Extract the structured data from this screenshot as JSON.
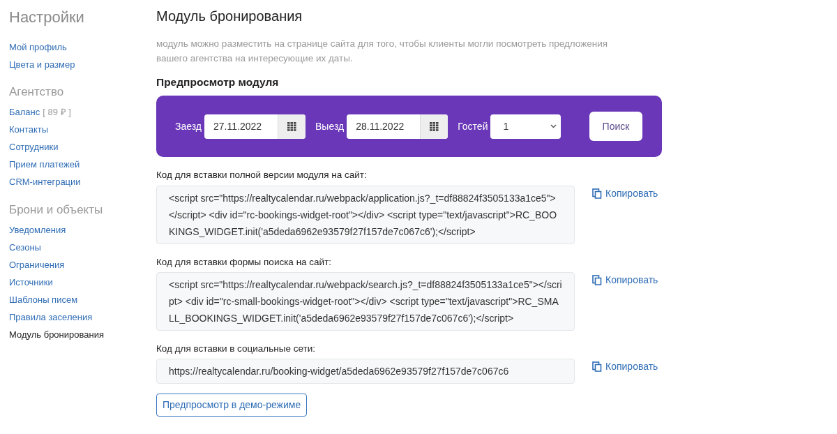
{
  "sidebar": {
    "title": "Настройки",
    "sections": [
      {
        "items": [
          {
            "label": "Мой профиль",
            "selected": false
          },
          {
            "label": "Цвета и размер",
            "selected": false
          }
        ]
      },
      {
        "heading": "Агентство",
        "items": [
          {
            "label": "Баланс",
            "suffix": "[ 89 ₽ ]",
            "selected": false
          },
          {
            "label": "Контакты",
            "selected": false
          },
          {
            "label": "Сотрудники",
            "selected": false
          },
          {
            "label": "Прием платежей",
            "selected": false
          },
          {
            "label": "CRM-интеграции",
            "selected": false
          }
        ]
      },
      {
        "heading": "Брони и объекты",
        "items": [
          {
            "label": "Уведомления",
            "selected": false
          },
          {
            "label": "Сезоны",
            "selected": false
          },
          {
            "label": "Ограничения",
            "selected": false
          },
          {
            "label": "Источники",
            "selected": false
          },
          {
            "label": "Шаблоны писем",
            "selected": false
          },
          {
            "label": "Правила заселения",
            "selected": false
          },
          {
            "label": "Модуль бронирования",
            "selected": true
          }
        ]
      }
    ]
  },
  "main": {
    "title": "Модуль бронирования",
    "description": "модуль можно разместить на странице сайта для того, чтобы клиенты могли посмотреть предложения вашего агентства на интересующие их даты.",
    "preview_heading": "Предпросмотр модуля",
    "widget": {
      "checkin_label": "Заезд",
      "checkin_value": "27.11.2022",
      "checkout_label": "Выезд",
      "checkout_value": "28.11.2022",
      "guests_label": "Гостей",
      "guests_value": "1",
      "search_button": "Поиск"
    },
    "code_blocks": [
      {
        "label": "Код для вставки полной версии модуля на сайт:",
        "code": "<script src=\"https://realtycalendar.ru/webpack/application.js?_t=df88824f3505133a1ce5\"></script> <div id=\"rc-bookings-widget-root\"></div> <script type=\"text/javascript\">RC_BOOKINGS_WIDGET.init('a5deda6962e93579f27f157de7c067c6');</script>",
        "copy": "Копировать"
      },
      {
        "label": "Код для вставки формы поиска на сайт:",
        "code": "<script src=\"https://realtycalendar.ru/webpack/search.js?_t=df88824f3505133a1ce5\"></script> <div id=\"rc-small-bookings-widget-root\"></div> <script type=\"text/javascript\">RC_SMALL_BOOKINGS_WIDGET.init('a5deda6962e93579f27f157de7c067c6');</script>",
        "copy": "Копировать"
      },
      {
        "label": "Код для вставки в социальные сети:",
        "code": "https://realtycalendar.ru/booking-widget/a5deda6962e93579f27f157de7c067c6",
        "copy": "Копировать"
      }
    ],
    "demo_button": "Предпросмотр в демо-режиме"
  }
}
